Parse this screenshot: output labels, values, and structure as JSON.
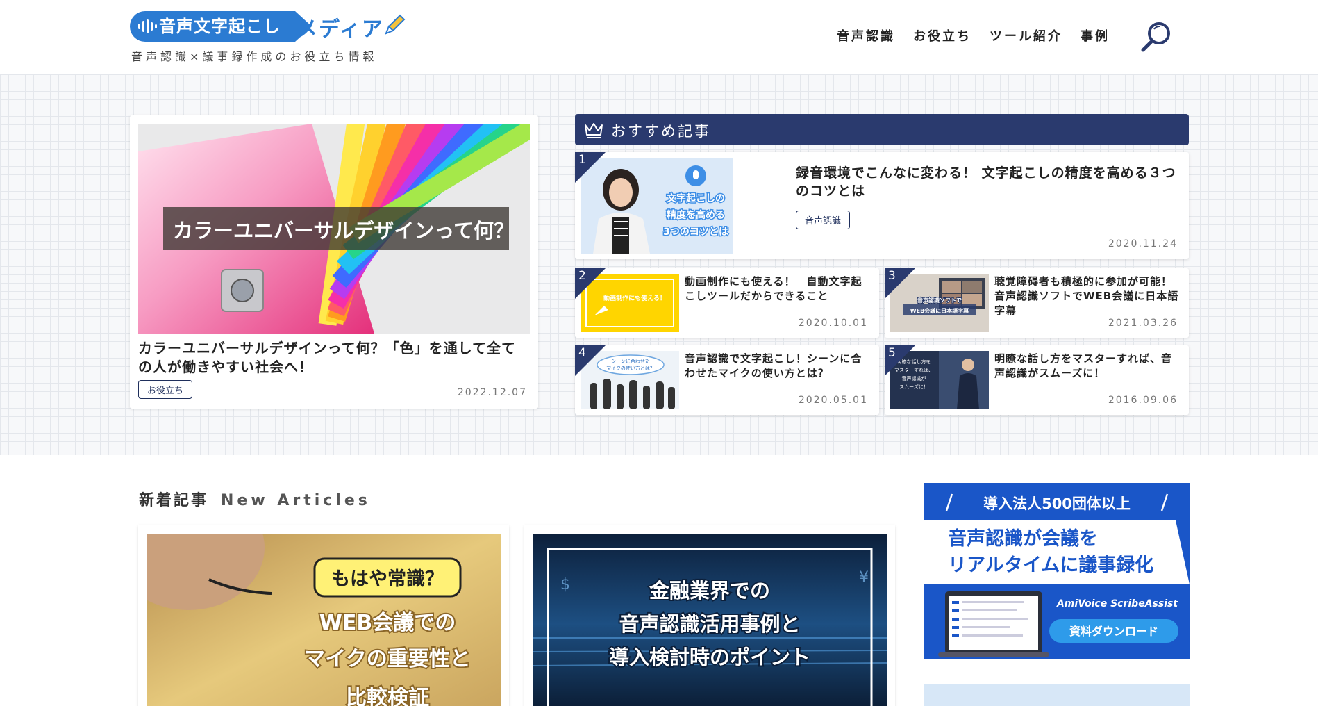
{
  "site": {
    "logo_main": "音声文字起こし",
    "logo_media": "メディア",
    "tagline": "音声認識×議事録作成のお役立ち情報"
  },
  "nav": [
    "音声認識",
    "お役立ち",
    "ツール紹介",
    "事例"
  ],
  "featured": {
    "image_text": "カラーユニバーサルデザインって何？",
    "title": "カラーユニバーサルデザインって何？「色」を通して全ての人が働きやすい社会へ！",
    "tag": "お役立ち",
    "date": "2022.12.07"
  },
  "recommended": {
    "heading": "おすすめ記事",
    "items": [
      {
        "rank": "1",
        "title": "録音環境でこんなに変わる！ 文字起こしの精度を高める３つのコツとは",
        "tag": "音声認識",
        "date": "2020.11.24",
        "thumb_lines": [
          "文字起こしの",
          "精度を高める",
          "3つのコツとは"
        ]
      },
      {
        "rank": "2",
        "title": "動画制作にも使える！　自動文字起こしツールだからできること",
        "date": "2020.10.01",
        "thumb_text": "動画制作にも使える！"
      },
      {
        "rank": "3",
        "title": "聴覚障碍者も積極的に参加が可能！音声認識ソフトでWEB会議に日本語字幕",
        "date": "2021.03.26",
        "thumb_lines": [
          "音声認識ソフトで",
          "WEB会議に日本語字幕"
        ]
      },
      {
        "rank": "4",
        "title": "音声認識で文字起こし！シーンに合わせたマイクの使い方とは？",
        "date": "2020.05.01",
        "thumb_lines": [
          "シーンに合わせた",
          "マイクの使い方とは？"
        ]
      },
      {
        "rank": "5",
        "title": "明瞭な話し方をマスターすれば、音声認識がスムーズに！",
        "date": "2016.09.06",
        "thumb_lines": [
          "明瞭な話し方を",
          "マスターすれば、",
          "音声認識が",
          "スムーズに！"
        ]
      }
    ]
  },
  "new_articles": {
    "heading": "新着記事",
    "heading_en": "New Articles",
    "items": [
      {
        "thumb_lines": [
          "もはや常識？",
          "WEB会議での",
          "マイクの重要性と",
          "比較検証"
        ]
      },
      {
        "thumb_lines": [
          "金融業界での",
          "音声認識活用事例と",
          "導入検討時のポイント"
        ]
      }
    ]
  },
  "ad": {
    "top": "導入法人500団体以上",
    "line1": "音声認識が会議を",
    "line2": "リアルタイムに議事録化",
    "brand": "AmiVoice ScribeAssist",
    "cta": "資料ダウンロード"
  },
  "colors": {
    "brand_blue": "#2b7bd2",
    "navy": "#2a3a6e",
    "ad_blue": "#1a56c8"
  }
}
